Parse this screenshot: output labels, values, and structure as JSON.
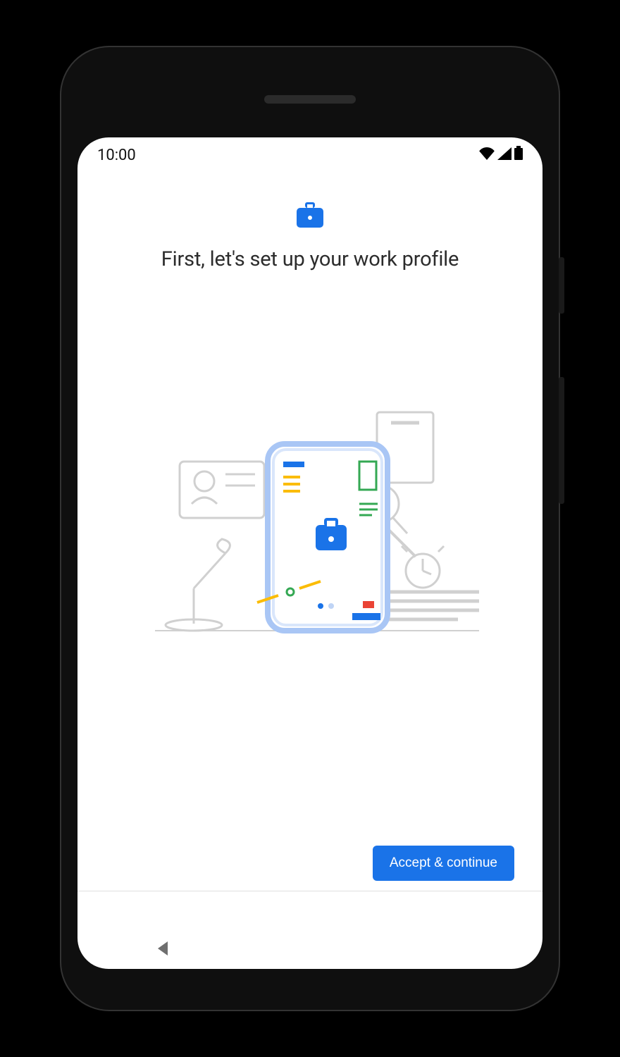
{
  "status": {
    "time": "10:00"
  },
  "header": {
    "title": "First, let's set up your work profile"
  },
  "footer": {
    "primary_button": "Accept & continue"
  },
  "icons": {
    "briefcase": "briefcase-icon",
    "wifi": "wifi-icon",
    "signal": "signal-icon",
    "battery": "battery-icon",
    "back": "back-icon"
  }
}
